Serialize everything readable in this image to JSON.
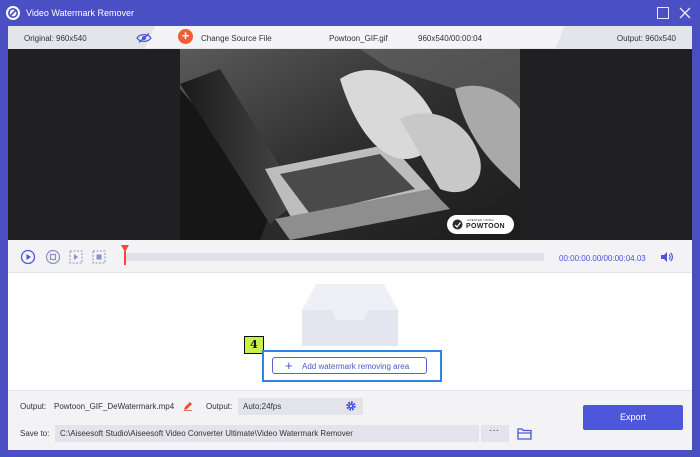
{
  "window": {
    "title": "Video Watermark Remover"
  },
  "infobar": {
    "original_label": "Original: 960x540",
    "change_source_label": "Change Source File",
    "file_name": "Powtoon_GIF.gif",
    "file_meta": "960x540/00:00:04",
    "output_label": "Output: 960x540"
  },
  "preview": {
    "watermark_small_text": "CREATED USING",
    "watermark_big_text": "POWTOON"
  },
  "playback": {
    "time": "00:00:00.00/00:00:04.03",
    "progress": 0
  },
  "area": {
    "step_number": "4",
    "add_button_label": "Add watermark removing area"
  },
  "settings": {
    "output_label": "Output:",
    "output_file": "Powtoon_GIF_DeWatermark.mp4",
    "format_label": "Output:",
    "format_value": "Auto;24fps",
    "save_label": "Save to:",
    "save_path": "C:\\Aiseesoft Studio\\Aiseesoft Video Converter Ultimate\\Video Watermark Remover",
    "more_label": "···",
    "export_label": "Export"
  },
  "colors": {
    "accent": "#4e57d9",
    "titlebar": "#4a4fc4",
    "plus": "#f25d33",
    "highlight": "#2f82e6",
    "step_badge": "#c8f04a"
  }
}
